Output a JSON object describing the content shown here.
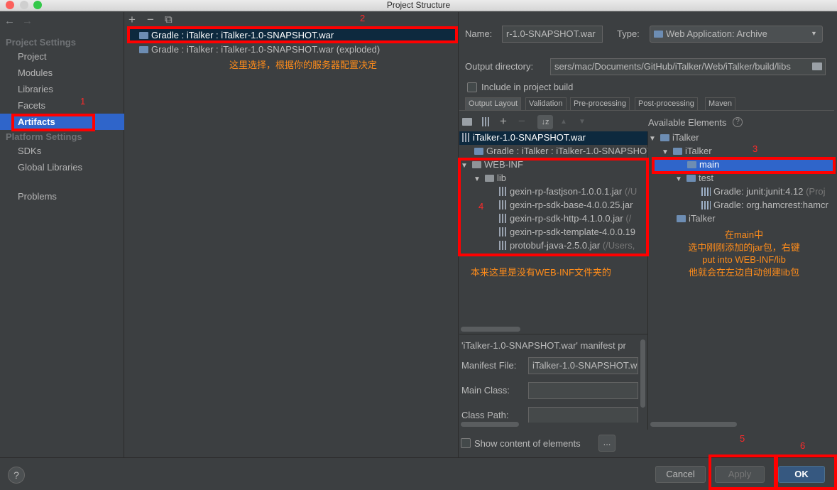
{
  "window": {
    "title": "Project Structure"
  },
  "sidebar": {
    "back": "←",
    "forward": "→",
    "project_settings": "Project Settings",
    "items1": [
      "Project",
      "Modules",
      "Libraries",
      "Facets",
      "Artifacts"
    ],
    "platform_settings": "Platform Settings",
    "items2": [
      "SDKs",
      "Global Libraries"
    ],
    "problems": "Problems"
  },
  "artifacts": {
    "toolbar": {
      "add": "+",
      "remove": "−",
      "copy": "⧉"
    },
    "list": [
      "Gradle : iTalker : iTalker-1.0-SNAPSHOT.war",
      "Gradle : iTalker : iTalker-1.0-SNAPSHOT.war (exploded)"
    ]
  },
  "detail": {
    "name_label": "Name:",
    "name_value": "r-1.0-SNAPSHOT.war",
    "type_label": "Type:",
    "type_value": "Web Application: Archive",
    "output_label": "Output directory:",
    "output_value": "sers/mac/Documents/GitHub/iTalker/Web/iTalker/build/libs",
    "include_label": "Include in project build",
    "tabs": [
      "Output Layout",
      "Validation",
      "Pre-processing",
      "Post-processing",
      "Maven"
    ],
    "available_label": "Available Elements",
    "help": "?"
  },
  "layout_tree": {
    "root": "iTalker-1.0-SNAPSHOT.war",
    "gradle_item": "Gradle : iTalker : iTalker-1.0-SNAPSHOT.war",
    "webinf": "WEB-INF",
    "lib": "lib",
    "jars": [
      {
        "name": "gexin-rp-fastjson-1.0.0.1.jar",
        "path": "(/U"
      },
      {
        "name": "gexin-rp-sdk-base-4.0.0.25.jar",
        "path": ""
      },
      {
        "name": "gexin-rp-sdk-http-4.1.0.0.jar",
        "path": "(/"
      },
      {
        "name": "gexin-rp-sdk-template-4.0.0.19",
        "path": ""
      },
      {
        "name": "protobuf-java-2.5.0.jar",
        "path": "(/Users,"
      }
    ]
  },
  "available_tree": {
    "root": "iTalker",
    "child": "iTalker",
    "main": "main",
    "test": "test",
    "libs": [
      {
        "name": "Gradle: junit:junit:4.12",
        "path": "(Proj"
      },
      {
        "name": "Gradle: org.hamcrest:hamcr",
        "path": ""
      }
    ],
    "second_root": "iTalker"
  },
  "manifest": {
    "header": "'iTalker-1.0-SNAPSHOT.war' manifest pr",
    "file_label": "Manifest File:",
    "file_value": "iTalker-1.0-SNAPSHOT.w",
    "main_class_label": "Main Class:",
    "class_path_label": "Class Path:"
  },
  "bottom": {
    "show_content_label": "Show content of elements",
    "ellipsis": "...",
    "help": "?",
    "cancel": "Cancel",
    "apply": "Apply",
    "ok": "OK"
  },
  "annotations": {
    "n1": "1",
    "n2": "2",
    "n3": "3",
    "n4": "4",
    "n5": "5",
    "n6": "6",
    "select_note": "这里选择，根据你的服务器配置决定",
    "webinf_note": "本来这里是没有WEB-INF文件夹的",
    "main_note": [
      "在main中",
      "选中刚刚添加的jar包，右键",
      "put into WEB-INF/lib",
      "他就会在左边自动创建lib包"
    ]
  },
  "colors": {
    "selection": "#2f65ca",
    "annotation_red": "#ff0000",
    "annotation_orange": "#ff8c1a",
    "background": "#3c3f41"
  }
}
